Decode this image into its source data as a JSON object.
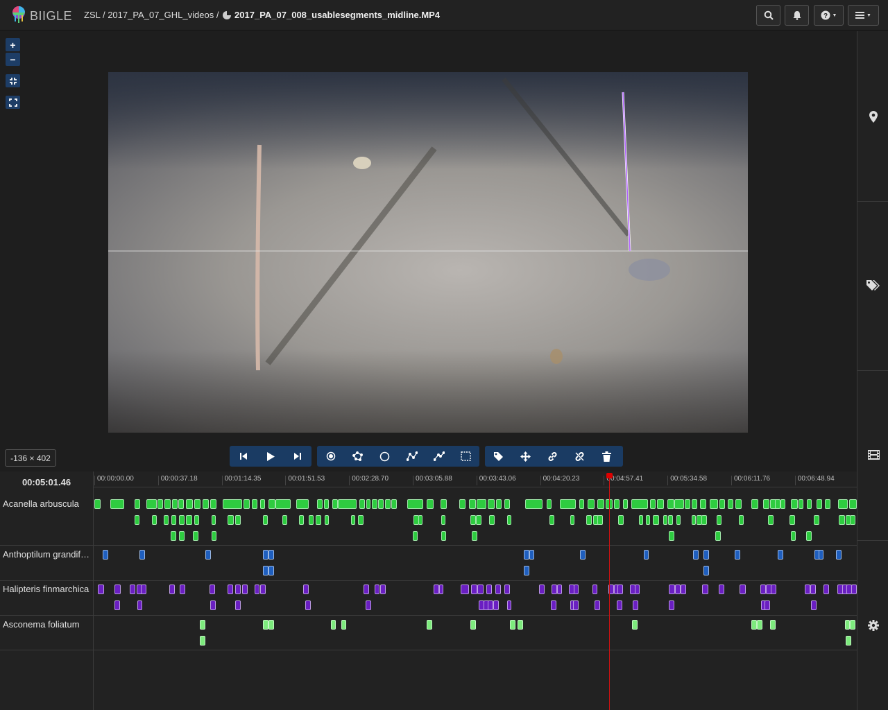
{
  "navbar": {
    "brand": "BIIGLE",
    "project": "ZSL",
    "volume": "2017_PA_07_GHL_videos",
    "separator": " / ",
    "file": "2017_PA_07_008_usablesegments_midline.MP4"
  },
  "icons": {
    "search": "search-icon",
    "notifications": "bell-icon",
    "help": "question-icon",
    "menu": "hamburger-icon",
    "sidebar": [
      "map-marker-icon",
      "tags-icon",
      "film-icon",
      "gear-icon"
    ]
  },
  "map_controls": {
    "zoom_in": "+",
    "zoom_out": "−"
  },
  "cursor_coordinates": "-136 × 402",
  "timeline": {
    "current_time": "00:05:01.46",
    "ticks": [
      "00:00:00.00",
      "00:00:37.18",
      "00:01:14.35",
      "00:01:51.53",
      "00:02:28.70",
      "00:03:05.88",
      "00:03:43.06",
      "00:04:20.23",
      "00:04:57.41",
      "00:05:34.58",
      "00:06:11.76",
      "00:06:48.94"
    ],
    "playhead_fraction": 0.675,
    "tracks": [
      {
        "name": "Acanella arbuscula",
        "color": "#2ecc40"
      },
      {
        "name": "Anthoptilum grandifl…",
        "color": "#1f5fbf"
      },
      {
        "name": "Halipteris finmarchica",
        "color": "#6a1fc2"
      },
      {
        "name": "Asconema foliatum",
        "color": "#7dea7d"
      }
    ]
  },
  "colors": {
    "accent": "#1a3b63",
    "annotation_purple": "#b060ff",
    "playhead": "#cc1111"
  }
}
